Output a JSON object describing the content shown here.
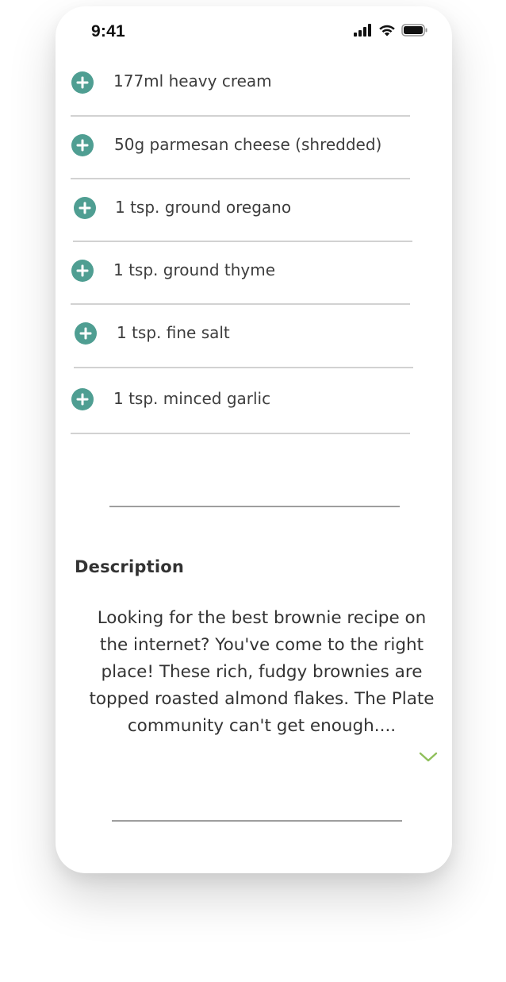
{
  "status_bar": {
    "time": "9:41",
    "icons": [
      "cellular-signal-icon",
      "wifi-icon",
      "battery-icon"
    ]
  },
  "ingredients": [
    {
      "label": "177ml heavy cream",
      "icon": "plus-circle-icon"
    },
    {
      "label": "50g parmesan cheese (shredded)",
      "icon": "plus-circle-icon"
    },
    {
      "label": "1 tsp. ground oregano",
      "icon": "plus-circle-icon"
    },
    {
      "label": "1 tsp. ground thyme",
      "icon": "plus-circle-icon"
    },
    {
      "label": "1 tsp. fine salt",
      "icon": "plus-circle-icon"
    },
    {
      "label": "1 tsp. minced garlic",
      "icon": "plus-circle-icon"
    }
  ],
  "description": {
    "title": "Description",
    "text": "Looking for the best brownie recipe on the internet? You've come to the right place! These rich, fudgy brownies are topped roasted almond flakes. The Plate community can't get enough....",
    "expand_icon": "chevron-down-icon"
  },
  "colors": {
    "accent": "#4f9e92",
    "chevron": "#8fbf5a",
    "text": "#3d3d3d",
    "divider": "#d2d2d2"
  }
}
